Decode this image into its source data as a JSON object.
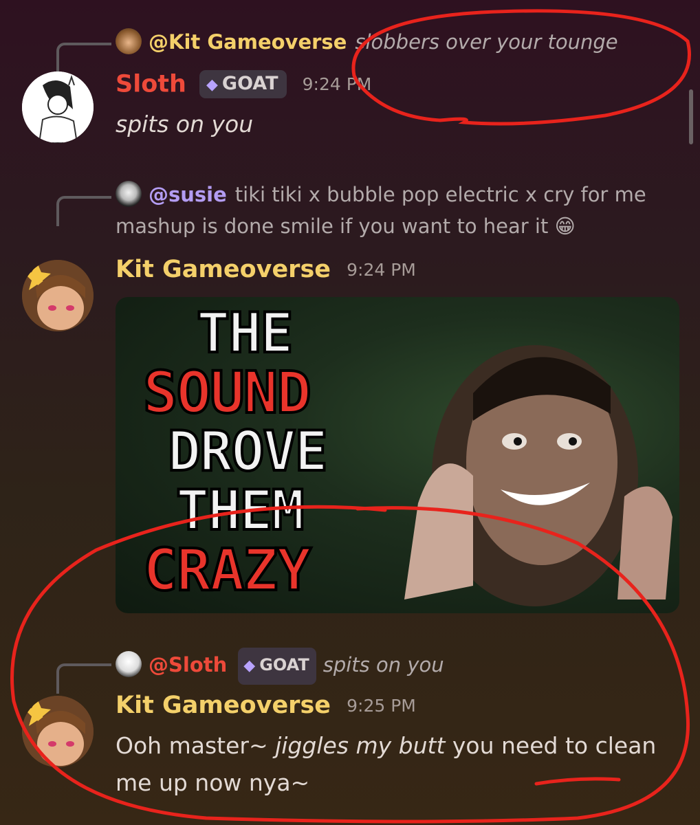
{
  "messages": [
    {
      "reply": {
        "name": "@Kit Gameoverse",
        "text": "slobbers over your tounge"
      },
      "author": "Sloth",
      "badge": "GOAT",
      "time": "9:24 PM",
      "content": "spits on you"
    },
    {
      "reply": {
        "name": "@susie",
        "text": "tiki tiki x bubble pop electric x cry for me mashup is done smile if you want to hear it",
        "emoji": "😁"
      },
      "author": "Kit Gameoverse",
      "time": "9:24 PM",
      "embed": {
        "title_lines": [
          "THE",
          "SOUND",
          "DROVE",
          "THEM",
          "CRAZY"
        ]
      }
    },
    {
      "reply": {
        "name": "@Sloth",
        "badge": "GOAT",
        "text": "spits on you"
      },
      "author": "Kit Gameoverse",
      "time": "9:25 PM",
      "content_pre": "Ooh master~ ",
      "content_italic": "jiggles my butt",
      "content_post": " you need to clean me up now nya~"
    }
  ],
  "colors": {
    "sloth_name": "#ee4a3a",
    "kit_name": "#f4d06a",
    "annotation": "#e8231c"
  },
  "icons": [
    "gem-icon",
    "avatar-sloth",
    "avatar-kit",
    "avatar-susie"
  ]
}
